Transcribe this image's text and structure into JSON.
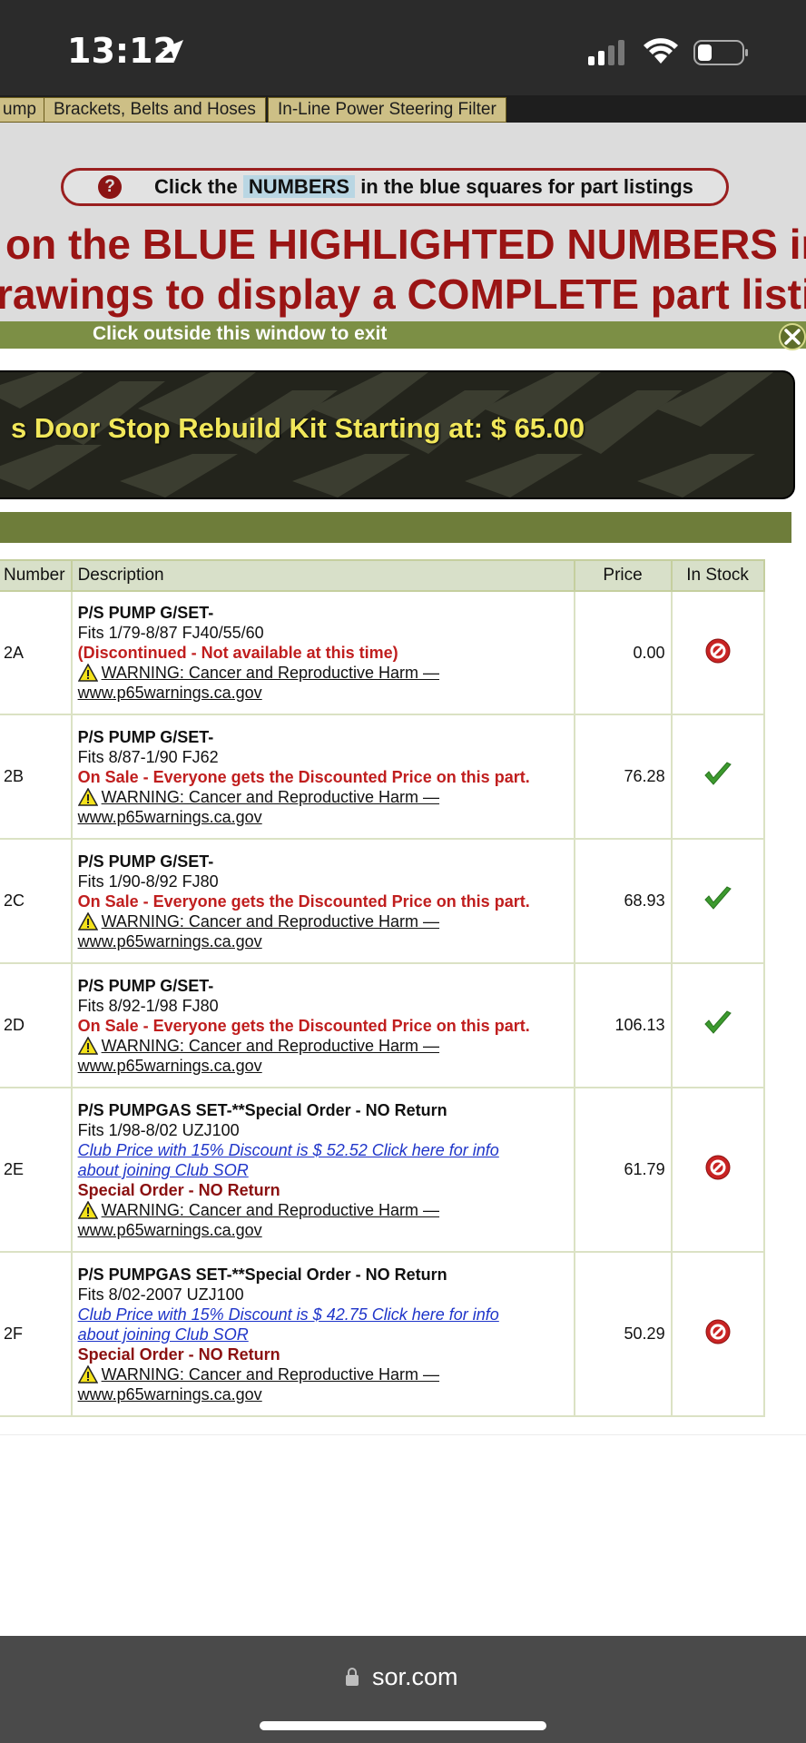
{
  "status_bar": {
    "time": "13:12"
  },
  "tabs": [
    "ump",
    "Brackets, Belts and Hoses",
    "In-Line Power Steering Filter"
  ],
  "hint": {
    "before": "Click the",
    "highlight": "NUMBERS",
    "after": "in the blue squares for part listings",
    "icon": "?"
  },
  "big_text": {
    "line1": "on the BLUE HIGHLIGHTED NUMBERS in",
    "line2": "rawings to display a COMPLETE part listi"
  },
  "popup": {
    "exit_text": "Click outside this window to exit"
  },
  "banner": {
    "text": "s Door Stop Rebuild Kit Starting at: $ 65.00"
  },
  "table": {
    "headers": {
      "number": "Number",
      "description": "Description",
      "price": "Price",
      "stock": "In Stock"
    },
    "rows": [
      {
        "number": "2A",
        "name": "P/S PUMP G/SET-",
        "fits": "Fits 1/79-8/87 FJ40/55/60",
        "note": "(Discontinued - Not available at this time)",
        "warn1": "WARNING: Cancer and Reproductive Harm —",
        "warn2": "www.p65warnings.ca.gov",
        "price": "0.00",
        "stock": "no"
      },
      {
        "number": "2B",
        "name": "P/S PUMP G/SET-",
        "fits": "Fits 8/87-1/90 FJ62",
        "note": "On Sale - Everyone gets the Discounted Price on this part.",
        "warn1": "WARNING: Cancer and Reproductive Harm —",
        "warn2": "www.p65warnings.ca.gov",
        "price": "76.28",
        "stock": "yes"
      },
      {
        "number": "2C",
        "name": "P/S PUMP G/SET-",
        "fits": "Fits 1/90-8/92 FJ80",
        "note": "On Sale - Everyone gets the Discounted Price on this part.",
        "warn1": "WARNING: Cancer and Reproductive Harm —",
        "warn2": "www.p65warnings.ca.gov",
        "price": "68.93",
        "stock": "yes"
      },
      {
        "number": "2D",
        "name": "P/S PUMP G/SET-",
        "fits": "Fits 8/92-1/98 FJ80",
        "note": "On Sale - Everyone gets the Discounted Price on this part.",
        "warn1": "WARNING: Cancer and Reproductive Harm —",
        "warn2": "www.p65warnings.ca.gov",
        "price": "106.13",
        "stock": "yes"
      },
      {
        "number": "2E",
        "name": "P/S PUMPGAS SET-**Special Order - NO Return",
        "fits": "Fits 1/98-8/02 UZJ100",
        "club1": "Club Price with 15% Discount is $ 52.52 Click here for info",
        "club2": "about joining Club SOR",
        "special": "Special Order - NO Return",
        "warn1": "WARNING: Cancer and Reproductive Harm —",
        "warn2": "www.p65warnings.ca.gov",
        "price": "61.79",
        "stock": "no"
      },
      {
        "number": "2F",
        "name": "P/S PUMPGAS SET-**Special Order - NO Return",
        "fits": "Fits 8/02-2007 UZJ100",
        "club1": "Club Price with 15% Discount is $ 42.75 Click here for info",
        "club2": "about joining Club SOR",
        "special": "Special Order - NO Return",
        "warn1": "WARNING: Cancer and Reproductive Harm —",
        "warn2": "www.p65warnings.ca.gov",
        "price": "50.29",
        "stock": "no"
      }
    ]
  },
  "browser": {
    "url": "sor.com"
  },
  "colors": {
    "olive": "#6e7d3a",
    "red_text": "#c01e1e",
    "link_blue": "#1f35c9",
    "yellow_banner": "#f1e75a"
  }
}
